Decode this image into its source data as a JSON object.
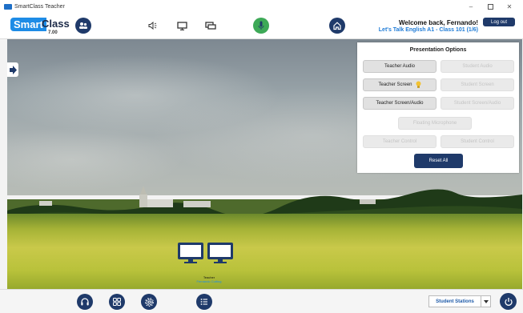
{
  "window": {
    "title": "SmartClass Teacher"
  },
  "header": {
    "logo_smart": "Smart",
    "logo_class": "Class",
    "version": "7.00",
    "welcome": "Welcome back, Fernando!",
    "course": "Let's Talk English A1 - Class 101 (1/6)",
    "logout_label": "Log out",
    "icons": [
      "students-icon",
      "volume-icon",
      "monitor-icon",
      "screens-icon",
      "microphone-icon",
      "home-icon"
    ]
  },
  "panel": {
    "title": "Presentation Options",
    "teacher_audio": "Teacher Audio",
    "student_audio": "Student Audio",
    "teacher_screen": "Teacher Screen",
    "student_screen": "Student Screen",
    "teacher_screen_audio": "Teacher Screen/Audio",
    "student_screen_audio": "Student Screen/Audio",
    "floating_microphone": "Floating Microphone",
    "teacher_control": "Teacher Control",
    "student_control": "Student Control",
    "reset_all": "Reset All"
  },
  "workspace": {
    "teacher_label": "Teacher",
    "teacher_name": "Fernando Cutting"
  },
  "footer": {
    "stations_label": "Student Stations",
    "icons": [
      "headset-icon",
      "grid-icon",
      "settings-icon",
      "list-icon",
      "power-icon"
    ]
  },
  "colors": {
    "brand_dark": "#1f3a6a",
    "brand_blue": "#1e8ce6",
    "mic_green": "#3da957"
  }
}
